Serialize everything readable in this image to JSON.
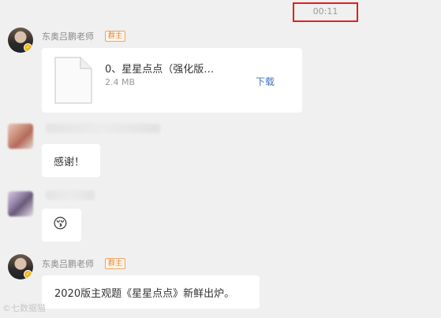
{
  "chat": {
    "timestamp": "00:11",
    "messages": [
      {
        "sender": "东奥吕鹏老师",
        "badge": "群主",
        "type": "file",
        "file": {
          "name": "0、星星点点（强化版…",
          "size": "2.4 MB",
          "action": "下载"
        }
      },
      {
        "type": "text",
        "text": "感谢！"
      },
      {
        "type": "emoji",
        "emoji": "😚"
      },
      {
        "sender": "东奥吕鹏老师",
        "badge": "群主",
        "type": "text",
        "text": "2020版主观题《星星点点》新鲜出炉。"
      }
    ]
  },
  "watermark": "©七数据猫"
}
